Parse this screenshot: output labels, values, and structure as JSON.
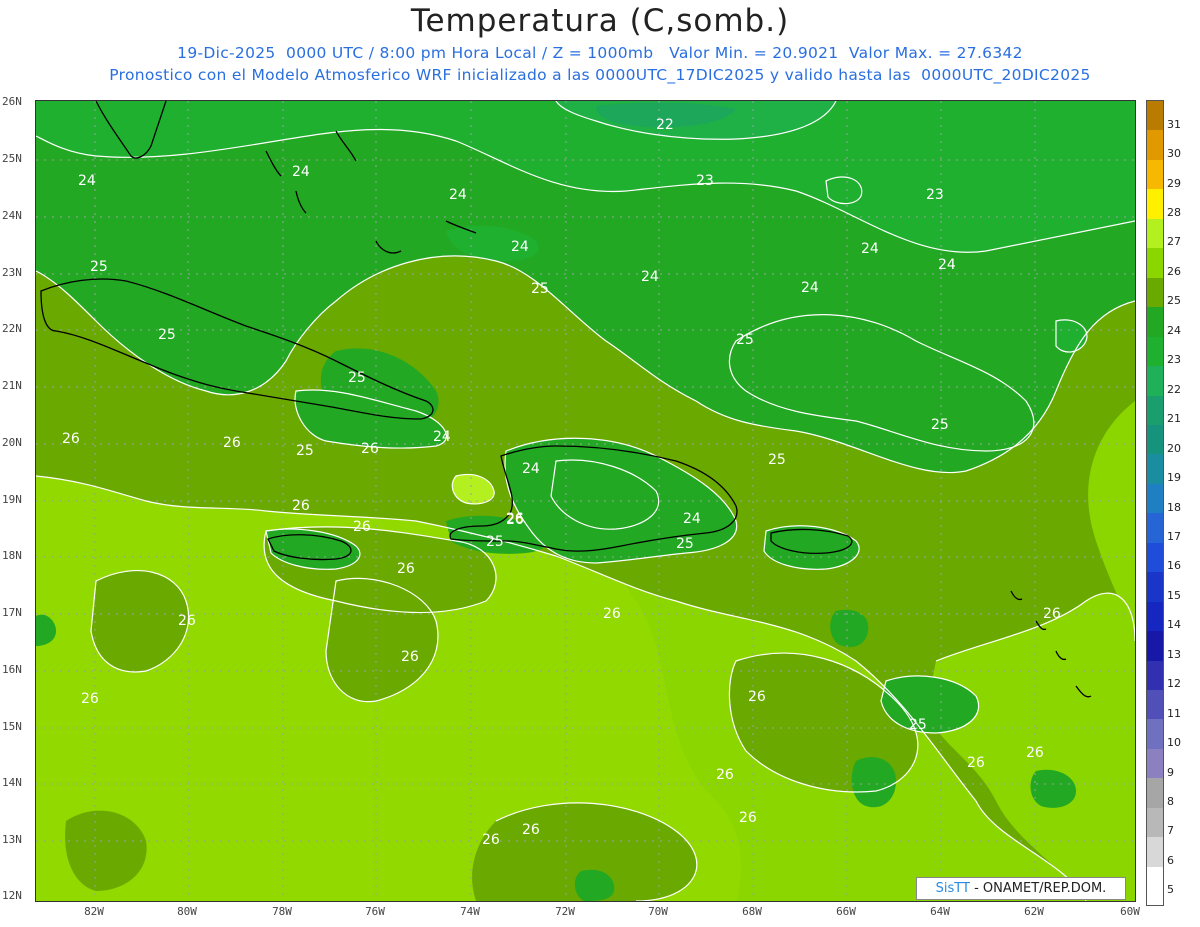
{
  "header": {
    "title": "Temperatura (C,somb.)",
    "subtitle_1": "19-Dic-2025  0000 UTC / 8:00 pm Hora Local / Z = 1000mb   Valor Min. = 20.9021  Valor Max. = 27.6342",
    "subtitle_2": "Pronostico con el Modelo Atmosferico WRF inicializado a las 0000UTC_17DIC2025 y valido hasta las  0000UTC_20DIC2025"
  },
  "axes": {
    "lat_labels": [
      "26N",
      "25N",
      "24N",
      "23N",
      "22N",
      "21N",
      "20N",
      "19N",
      "18N",
      "17N",
      "16N",
      "15N",
      "14N",
      "13N",
      "12N"
    ],
    "lon_labels": [
      "82W",
      "80W",
      "78W",
      "76W",
      "74W",
      "72W",
      "70W",
      "68W",
      "66W",
      "64W",
      "62W",
      "60W"
    ]
  },
  "colorbar": {
    "levels": [
      "31",
      "30",
      "29",
      "28",
      "27",
      "26",
      "25",
      "24",
      "23",
      "22",
      "21",
      "20",
      "19",
      "18",
      "17",
      "16",
      "15",
      "14",
      "13",
      "12",
      "11",
      "10",
      "9",
      "8",
      "7",
      "6",
      "5"
    ],
    "colors": [
      "#b97b00",
      "#e09a00",
      "#f6b800",
      "#fff000",
      "#b4f020",
      "#8cd600",
      "#6aaa00",
      "#22a822",
      "#20b030",
      "#1fb05a",
      "#1a9e6e",
      "#16937c",
      "#1a8ea0",
      "#1f7fc3",
      "#2565d6",
      "#1f4cd8",
      "#1a36c8",
      "#1626c0",
      "#1818a8",
      "#3030b0",
      "#5050b8",
      "#7070c0",
      "#8c80c0",
      "#a6a6a6",
      "#b8b8b8",
      "#d8d8d8",
      "#ffffff"
    ]
  },
  "contour_labels": [
    {
      "text": "22"
    },
    {
      "text": "23"
    },
    {
      "text": "23"
    },
    {
      "text": "24"
    },
    {
      "text": "24"
    },
    {
      "text": "24"
    },
    {
      "text": "24"
    },
    {
      "text": "24"
    },
    {
      "text": "24"
    },
    {
      "text": "24"
    },
    {
      "text": "24"
    },
    {
      "text": "25"
    },
    {
      "text": "25"
    },
    {
      "text": "25"
    },
    {
      "text": "25"
    },
    {
      "text": "25"
    },
    {
      "text": "25"
    },
    {
      "text": "25"
    },
    {
      "text": "24"
    },
    {
      "text": "26"
    },
    {
      "text": "26"
    },
    {
      "text": "26"
    },
    {
      "text": "25"
    },
    {
      "text": "24"
    },
    {
      "text": "26"
    },
    {
      "text": "26"
    },
    {
      "text": "24"
    },
    {
      "text": "25"
    },
    {
      "text": "26"
    },
    {
      "text": "26"
    },
    {
      "text": "26"
    },
    {
      "text": "26"
    },
    {
      "text": "26"
    },
    {
      "text": "26"
    },
    {
      "text": "26"
    },
    {
      "text": "25"
    },
    {
      "text": "26"
    },
    {
      "text": "26"
    },
    {
      "text": "26"
    },
    {
      "text": "26"
    },
    {
      "text": "26"
    },
    {
      "text": "26"
    },
    {
      "text": "26"
    },
    {
      "text": "25"
    },
    {
      "text": "26"
    }
  ],
  "credit": {
    "sis": "SisTT",
    "text": " - ONAMET/REP.DOM."
  }
}
